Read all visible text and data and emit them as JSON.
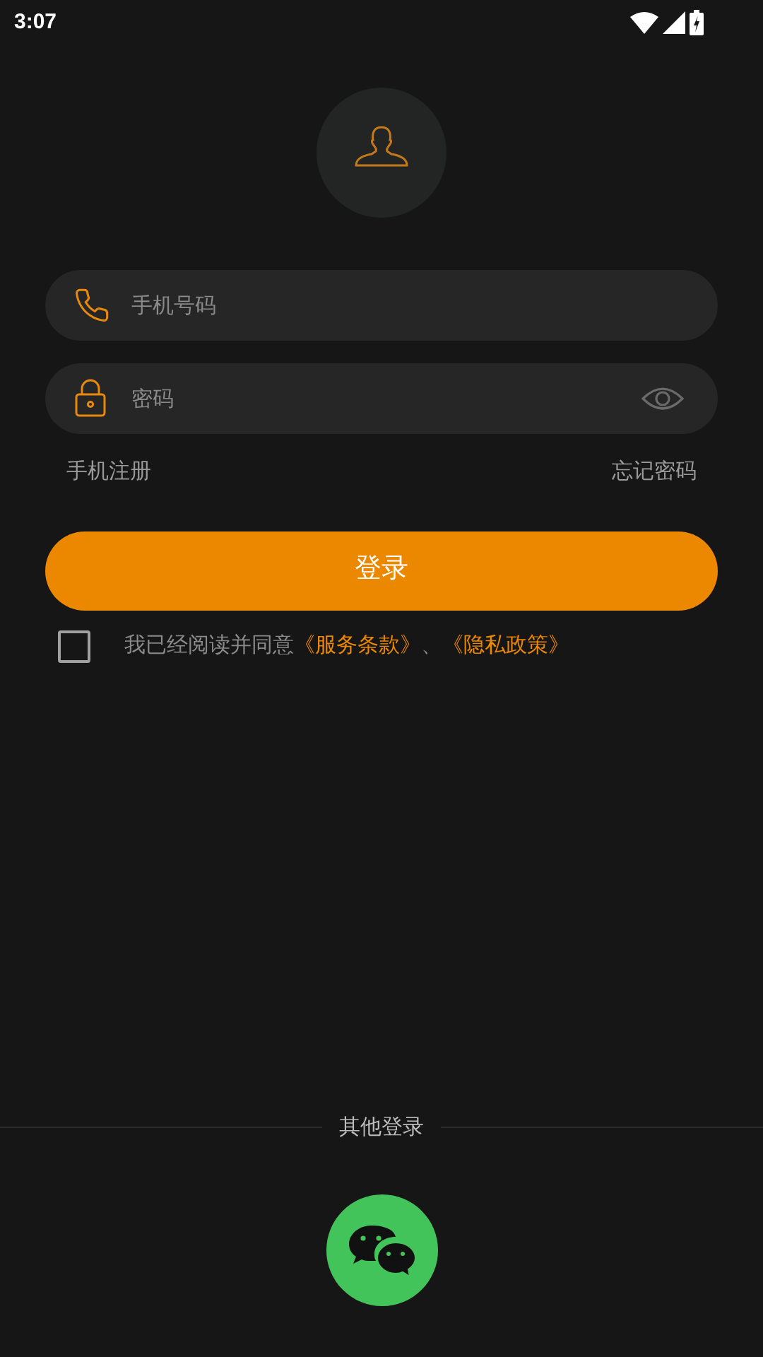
{
  "status_bar": {
    "time": "3:07"
  },
  "phone_field": {
    "placeholder": "手机号码"
  },
  "password_field": {
    "placeholder": "密码",
    "visible": false
  },
  "links": {
    "register": "手机注册",
    "forgot": "忘记密码"
  },
  "login_button": "登录",
  "agreement": {
    "checked": false,
    "text": "我已经阅读并同意",
    "links": [
      "《服务条款》",
      "《隐私政策》"
    ],
    "separator": "、"
  },
  "other_login": {
    "title": "其他登录"
  }
}
